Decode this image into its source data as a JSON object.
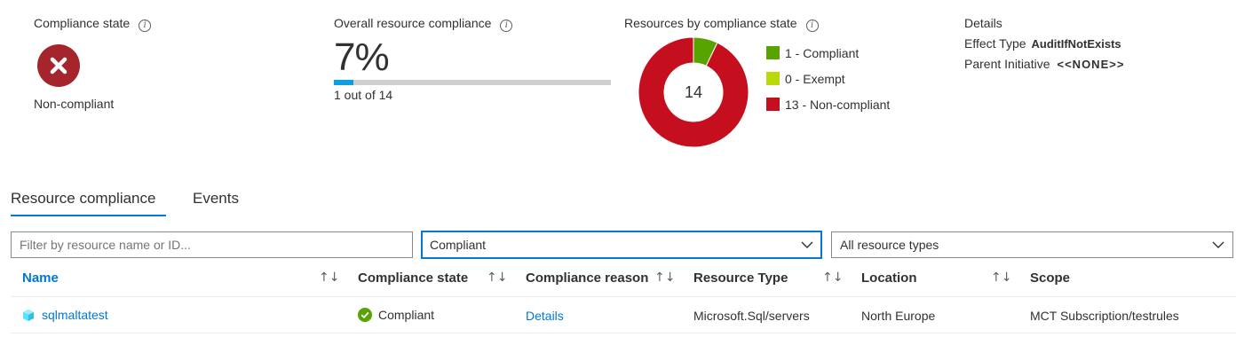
{
  "compliance_state": {
    "title": "Compliance state",
    "value": "Non-compliant",
    "status_color": "#a4262c"
  },
  "overall": {
    "title": "Overall resource compliance",
    "percent_text": "7%",
    "progress_fraction": 0.07,
    "subtitle": "1 out of 14",
    "bar_color": "#0f9fe0"
  },
  "by_state": {
    "title": "Resources by compliance state",
    "total": "14",
    "legend": [
      {
        "label": "1 - Compliant",
        "count": 1,
        "color": "#57a300"
      },
      {
        "label": "0 - Exempt",
        "count": 0,
        "color": "#bad80a"
      },
      {
        "label": "13 - Non-compliant",
        "count": 13,
        "color": "#c50f1f"
      }
    ]
  },
  "details": {
    "title": "Details",
    "effect_type_label": "Effect Type",
    "effect_type_value": "AuditIfNotExists",
    "parent_initiative_label": "Parent Initiative",
    "parent_initiative_value": "<<NONE>>"
  },
  "tabs": [
    {
      "label": "Resource compliance",
      "active": true
    },
    {
      "label": "Events",
      "active": false
    }
  ],
  "filters": {
    "search_placeholder": "Filter by resource name or ID...",
    "compliance_filter": "Compliant",
    "resource_type_filter": "All resource types"
  },
  "table": {
    "columns": [
      "Name",
      "Compliance state",
      "Compliance reason",
      "Resource Type",
      "Location",
      "Scope"
    ],
    "sort_glyph": "↑↓",
    "rows": [
      {
        "name": "sqlmaltatest",
        "compliance_state": "Compliant",
        "compliance_reason": "Details",
        "resource_type": "Microsoft.Sql/servers",
        "location": "North Europe",
        "scope": "MCT Subscription/testrules"
      }
    ]
  },
  "icons": {
    "error": "error-circle-icon",
    "info": "info-icon",
    "sort": "sort-icon",
    "chevron": "chevron-down-icon",
    "sql": "sql-server-icon",
    "check": "check-circle-icon"
  }
}
